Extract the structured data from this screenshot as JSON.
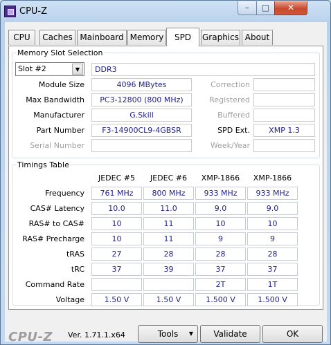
{
  "window": {
    "title": "CPU-Z",
    "minimize": "–",
    "maximize": "□",
    "close": "✕"
  },
  "tabs": [
    "CPU",
    "Caches",
    "Mainboard",
    "Memory",
    "SPD",
    "Graphics",
    "About"
  ],
  "active_tab": "SPD",
  "slot": {
    "legend": "Memory Slot Selection",
    "selected": "Slot #2",
    "type": "DDR3",
    "fields": [
      {
        "label": "Module Size",
        "value": "4096 MBytes"
      },
      {
        "label": "Max Bandwidth",
        "value": "PC3-12800 (800 MHz)"
      },
      {
        "label": "Manufacturer",
        "value": "G.Skill"
      },
      {
        "label": "Part Number",
        "value": "F3-14900CL9-4GBSR"
      },
      {
        "label": "Serial Number",
        "value": ""
      }
    ],
    "right_fields": [
      {
        "label": "Correction",
        "value": ""
      },
      {
        "label": "Registered",
        "value": ""
      },
      {
        "label": "Buffered",
        "value": ""
      },
      {
        "label": "SPD Ext.",
        "value": "XMP 1.3"
      },
      {
        "label": "Week/Year",
        "value": ""
      }
    ]
  },
  "timings": {
    "legend": "Timings Table",
    "columns": [
      "JEDEC #5",
      "JEDEC #6",
      "XMP-1866",
      "XMP-1866"
    ],
    "rows": [
      {
        "label": "Frequency",
        "values": [
          "761 MHz",
          "800 MHz",
          "933 MHz",
          "933 MHz"
        ]
      },
      {
        "label": "CAS# Latency",
        "values": [
          "10.0",
          "11.0",
          "9.0",
          "9.0"
        ]
      },
      {
        "label": "RAS# to CAS#",
        "values": [
          "10",
          "11",
          "10",
          "10"
        ]
      },
      {
        "label": "RAS# Precharge",
        "values": [
          "10",
          "11",
          "9",
          "9"
        ]
      },
      {
        "label": "tRAS",
        "values": [
          "27",
          "28",
          "28",
          "28"
        ]
      },
      {
        "label": "tRC",
        "values": [
          "37",
          "39",
          "37",
          "37"
        ]
      },
      {
        "label": "Command Rate",
        "values": [
          "",
          "",
          "2T",
          "1T"
        ]
      },
      {
        "label": "Voltage",
        "values": [
          "1.50 V",
          "1.50 V",
          "1.500 V",
          "1.500 V"
        ]
      }
    ]
  },
  "footer": {
    "brand": "CPU-Z",
    "version": "Ver. 1.71.1.x64",
    "tools": "Tools",
    "validate": "Validate",
    "ok": "OK"
  }
}
